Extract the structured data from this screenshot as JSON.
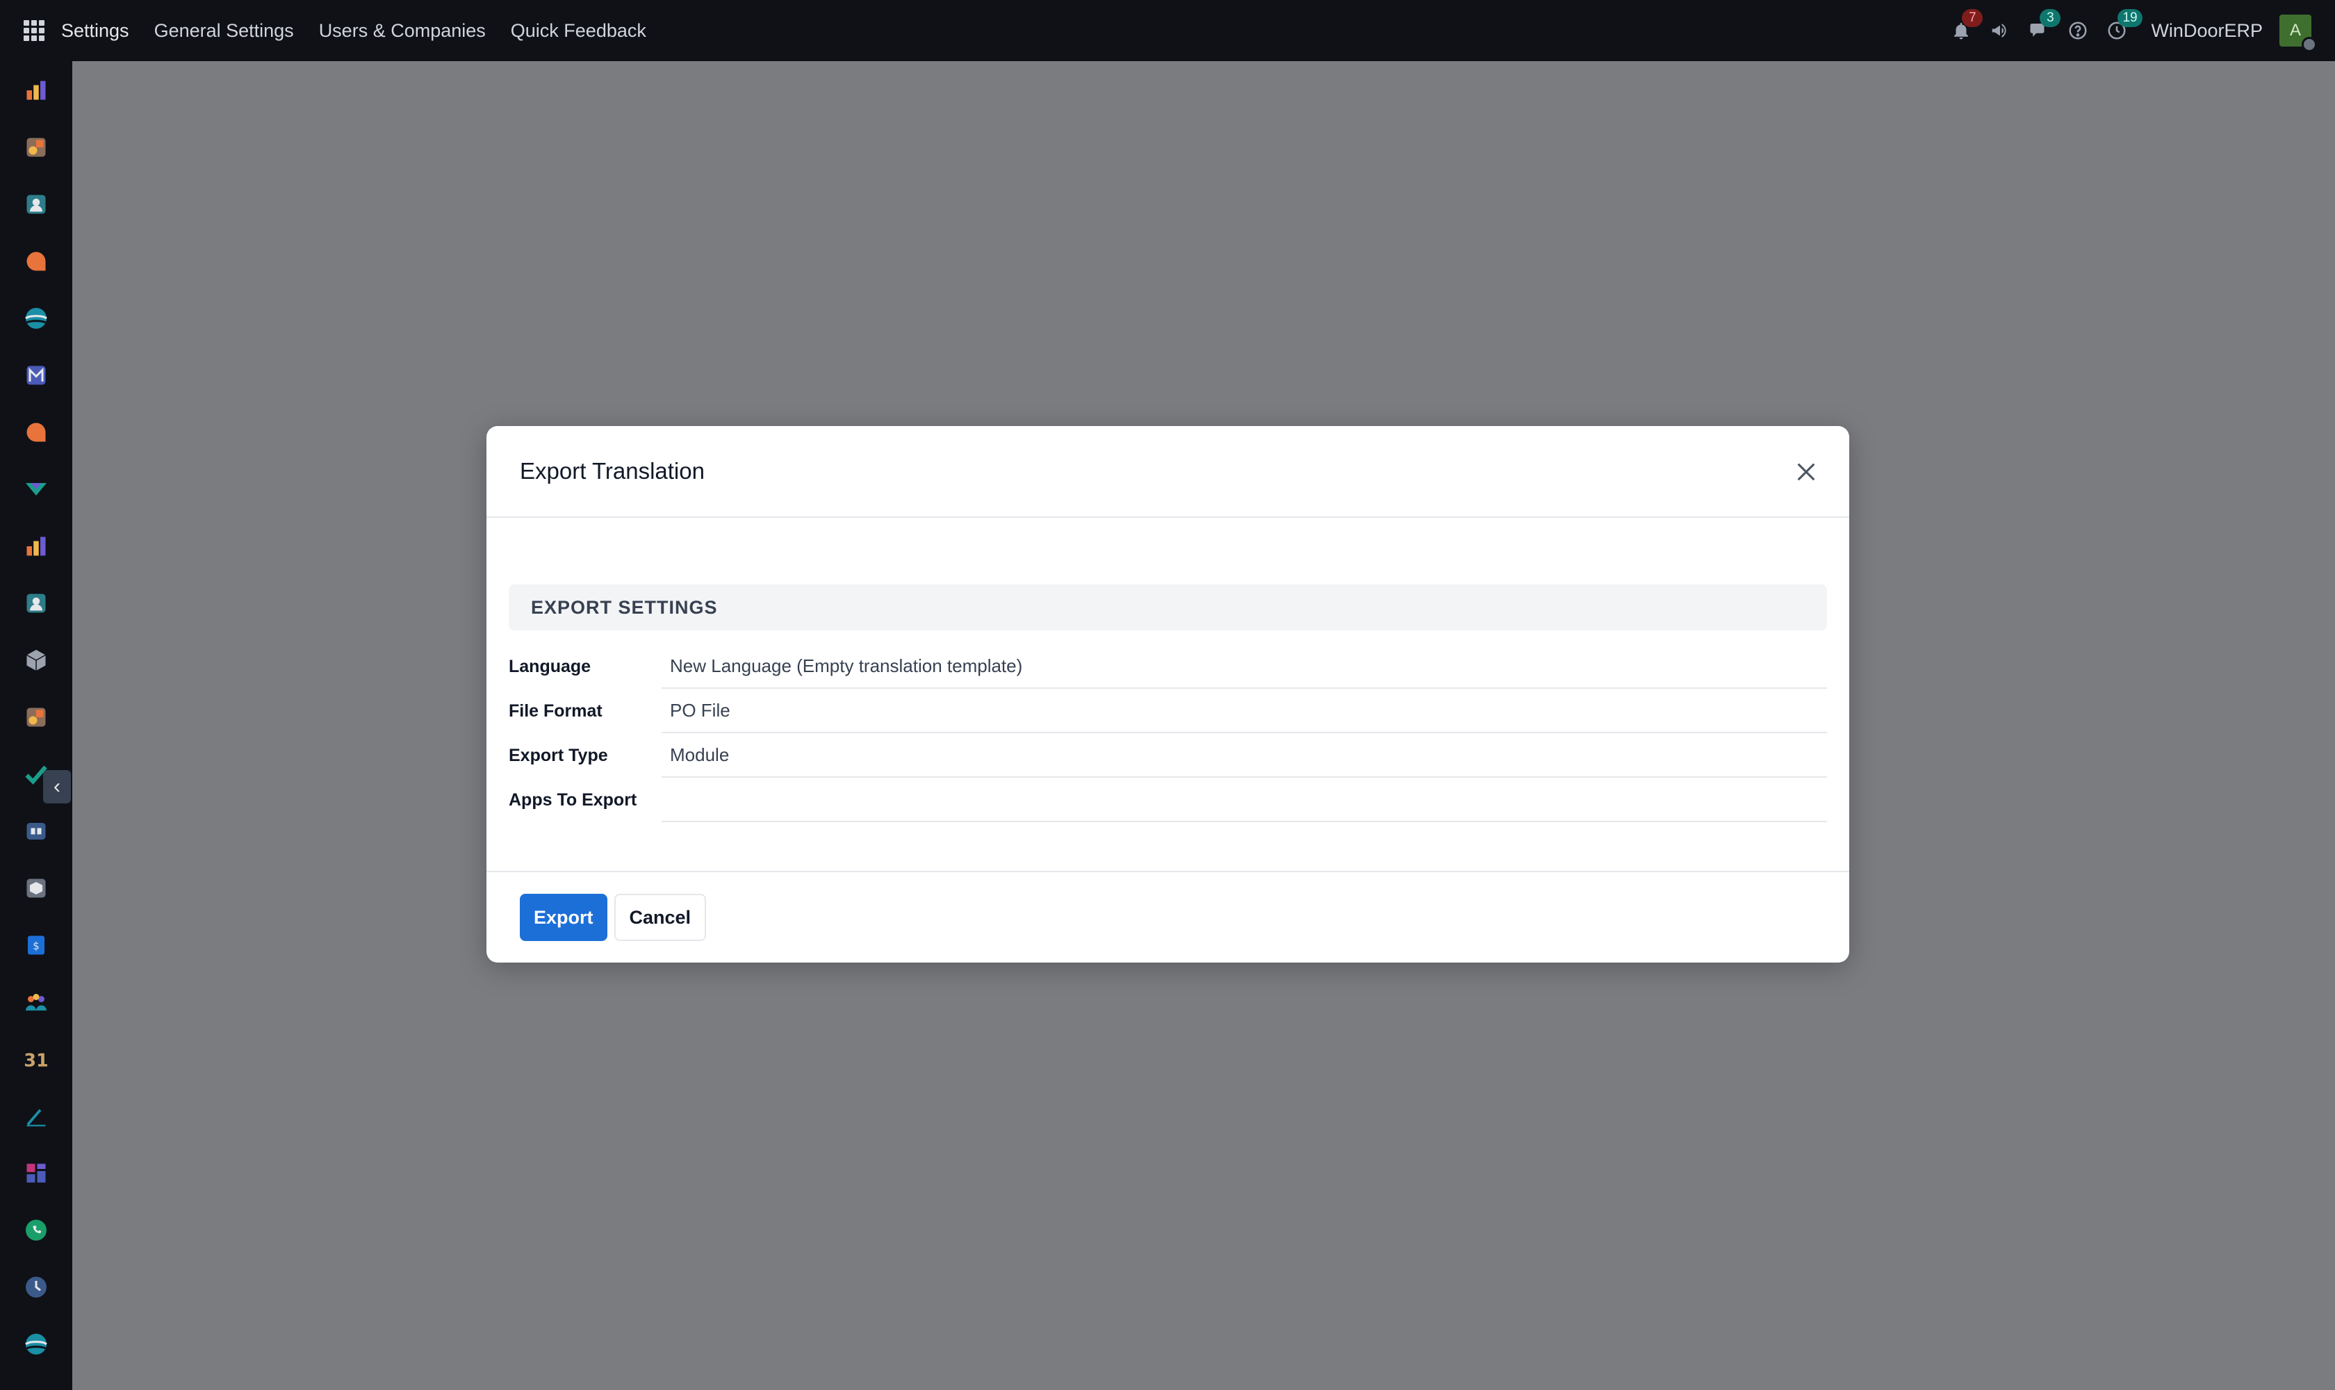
{
  "topbar": {
    "menu": [
      "Settings",
      "General Settings",
      "Users & Companies",
      "Quick Feedback"
    ],
    "company": "WinDoorERP",
    "avatar_letter": "A",
    "badges": {
      "notifications": "7",
      "messages": "3",
      "activities": "19"
    }
  },
  "modal": {
    "title": "Export Translation",
    "section_title": "EXPORT SETTINGS",
    "fields": [
      {
        "label": "Language",
        "value": "New Language (Empty translation template)"
      },
      {
        "label": "File Format",
        "value": "PO File"
      },
      {
        "label": "Export Type",
        "value": "Module"
      },
      {
        "label": "Apps To Export",
        "value": ""
      }
    ],
    "export_label": "Export",
    "cancel_label": "Cancel"
  },
  "colors": {
    "topbar_bg": "#0f1117",
    "overlay": "#7a7c80",
    "primary": "#1d6fd8"
  }
}
